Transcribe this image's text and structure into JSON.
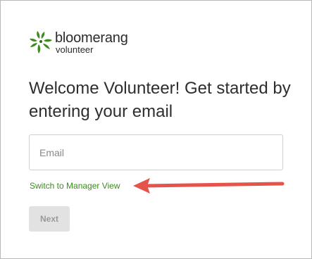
{
  "brand": {
    "name": "bloomerang",
    "product": "volunteer",
    "accent_color": "#3d8b1e",
    "logo_icon": "bloomerang-flower-icon"
  },
  "heading": "Welcome Volunteer! Get started by entering your email",
  "email_field": {
    "placeholder": "Email",
    "value": ""
  },
  "switch_link": "Switch to Manager View",
  "annotation": {
    "icon": "red-arrow-icon",
    "color": "#e5534b"
  },
  "next_button": {
    "label": "Next",
    "state": "disabled"
  }
}
